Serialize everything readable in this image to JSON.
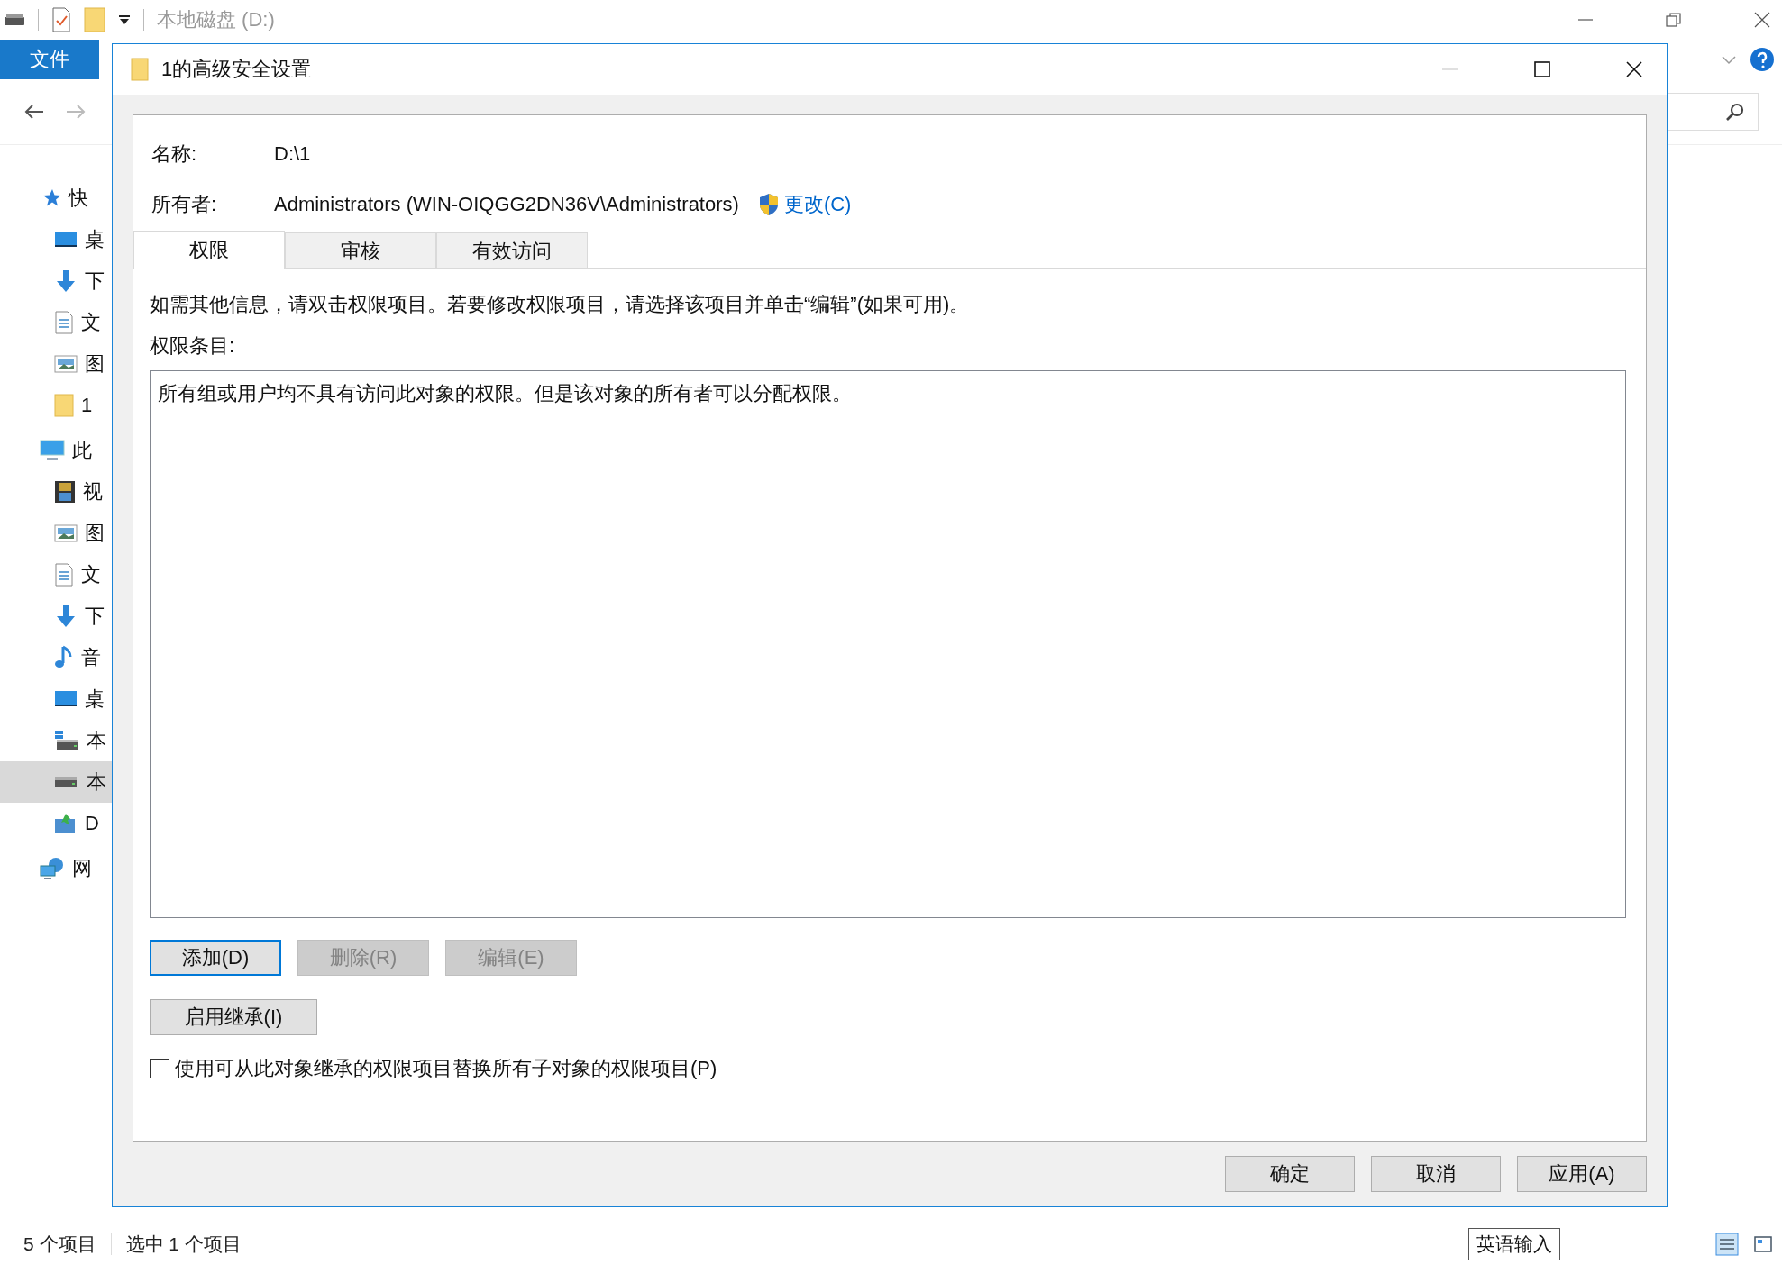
{
  "explorer": {
    "title": "本地磁盘 (D:)",
    "ribbon_tab": "文件",
    "sidebar": [
      {
        "label": "快",
        "kind": "star",
        "selected": false,
        "children": [
          {
            "label": "桌",
            "kind": "desktop",
            "selected": false
          },
          {
            "label": "下",
            "kind": "download",
            "selected": false
          },
          {
            "label": "文",
            "kind": "document",
            "selected": false
          },
          {
            "label": "图",
            "kind": "image",
            "selected": false
          },
          {
            "label": "1",
            "kind": "folder",
            "selected": false
          }
        ]
      },
      {
        "label": "此",
        "kind": "pc",
        "selected": false,
        "children": [
          {
            "label": "视",
            "kind": "video",
            "selected": false
          },
          {
            "label": "图",
            "kind": "image",
            "selected": false
          },
          {
            "label": "文",
            "kind": "document",
            "selected": false
          },
          {
            "label": "下",
            "kind": "download",
            "selected": false
          },
          {
            "label": "音",
            "kind": "music",
            "selected": false
          },
          {
            "label": "桌",
            "kind": "desktop",
            "selected": false
          },
          {
            "label": "本",
            "kind": "sysdrive",
            "selected": false
          },
          {
            "label": "本",
            "kind": "drive",
            "selected": true
          },
          {
            "label": "D",
            "kind": "dvd",
            "selected": false
          }
        ]
      },
      {
        "label": "网",
        "kind": "network",
        "selected": false
      }
    ],
    "status": [
      "5 个项目",
      "选中 1 个项目"
    ],
    "ime": "英语输入"
  },
  "dialog": {
    "title": "1的高级安全设置",
    "fields": [
      {
        "label": "名称:",
        "value": "D:\\1"
      },
      {
        "label": "所有者:",
        "value": "Administrators (WIN-OIQGG2DN36V\\Administrators)",
        "link": "更改(C)"
      }
    ],
    "tabs": [
      {
        "label": "权限",
        "selected": true
      },
      {
        "label": "审核",
        "selected": false
      },
      {
        "label": "有效访问",
        "selected": false
      }
    ],
    "info": "如需其他信息，请双击权限项目。若要修改权限项目，请选择该项目并单击“编辑”(如果可用)。",
    "list_label": "权限条目:",
    "list_message": "所有组或用户均不具有访问此对象的权限。但是该对象的所有者可以分配权限。",
    "entry_buttons": [
      {
        "label": "添加(D)",
        "disabled": false,
        "focused": true
      },
      {
        "label": "删除(R)",
        "disabled": true,
        "focused": false
      },
      {
        "label": "编辑(E)",
        "disabled": true,
        "focused": false
      }
    ],
    "inherit_button": "启用继承(I)",
    "replace_checkbox": {
      "label": "使用可从此对象继承的权限项目替换所有子对象的权限项目(P)",
      "checked": false
    },
    "footer_buttons": [
      "确定",
      "取消",
      "应用(A)"
    ]
  }
}
